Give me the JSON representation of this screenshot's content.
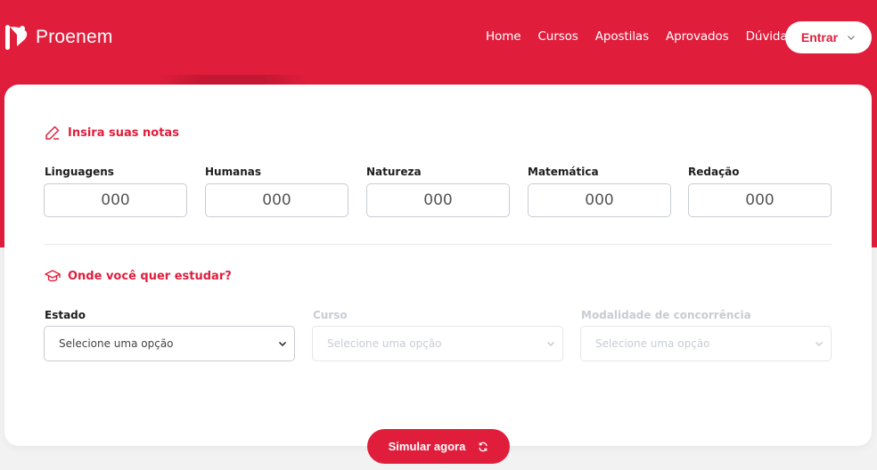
{
  "brand": {
    "name": "Proenem",
    "accent": "#e01e3c"
  },
  "nav": {
    "items": [
      "Home",
      "Cursos",
      "Apostilas",
      "Aprovados",
      "Dúvidas"
    ],
    "enter_label": "Entrar"
  },
  "grades_section": {
    "title": "Insira suas notas",
    "icon": "pencil-icon",
    "fields": [
      {
        "label": "Linguagens",
        "placeholder": "000"
      },
      {
        "label": "Humanas",
        "placeholder": "000"
      },
      {
        "label": "Natureza",
        "placeholder": "000"
      },
      {
        "label": "Matemática",
        "placeholder": "000"
      },
      {
        "label": "Redação",
        "placeholder": "000"
      }
    ]
  },
  "study_section": {
    "title": "Onde você quer estudar?",
    "icon": "graduation-cap-icon",
    "selects": [
      {
        "label": "Estado",
        "value": "Selecione uma opção",
        "disabled": false
      },
      {
        "label": "Curso",
        "value": "Selecione uma opção",
        "disabled": true
      },
      {
        "label": "Modalidade de concorrência",
        "value": "Selecione uma opção",
        "disabled": true
      }
    ]
  },
  "submit": {
    "label": "Simular agora",
    "icon": "refresh-icon"
  }
}
